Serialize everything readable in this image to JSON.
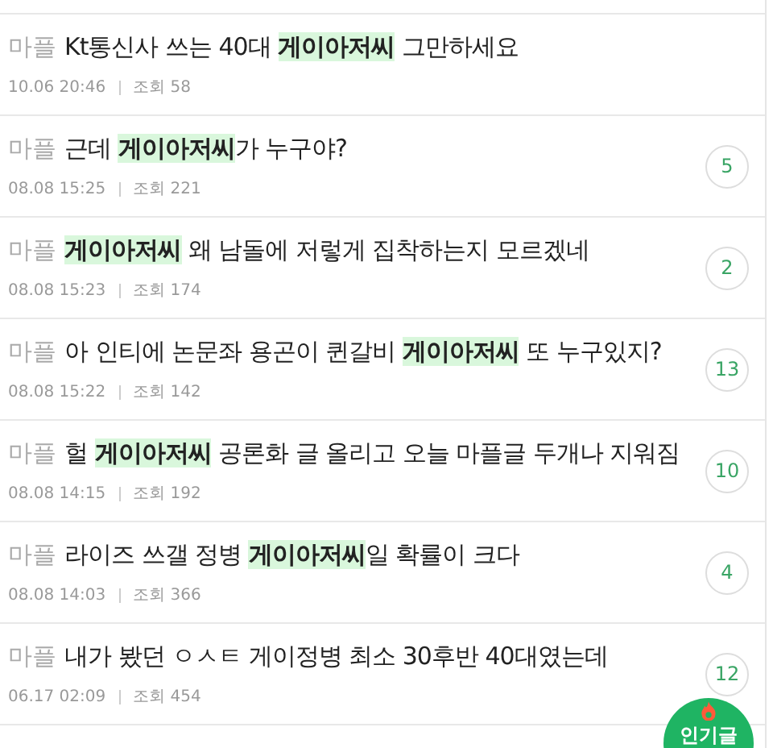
{
  "posts": [
    {
      "category": "마플",
      "title": [
        {
          "text": "Kt통신사 쓰는 40대 ",
          "highlight": false
        },
        {
          "text": "게이아저씨",
          "highlight": true
        },
        {
          "text": " 그만하세요",
          "highlight": false
        }
      ],
      "date": "10.06 20:46",
      "views": "조회 58"
    },
    {
      "category": "마플",
      "title": [
        {
          "text": "근데 ",
          "highlight": false
        },
        {
          "text": "게이아저씨",
          "highlight": true
        },
        {
          "text": "가 누구야?",
          "highlight": false
        }
      ],
      "date": "08.08 15:25",
      "views": "조회 221",
      "comments": "5"
    },
    {
      "category": "마플",
      "title": [
        {
          "text": "게이아저씨",
          "highlight": true
        },
        {
          "text": " 왜 남돌에 저렇게 집착하는지 모르겠네",
          "highlight": false
        }
      ],
      "date": "08.08 15:23",
      "views": "조회 174",
      "comments": "2"
    },
    {
      "category": "마플",
      "title": [
        {
          "text": "아 인티에 논문좌 용곤이 퀸갈비 ",
          "highlight": false
        },
        {
          "text": "게이아저씨",
          "highlight": true
        },
        {
          "text": " 또 누구있지?",
          "highlight": false
        }
      ],
      "date": "08.08 15:22",
      "views": "조회 142",
      "comments": "13"
    },
    {
      "category": "마플",
      "title": [
        {
          "text": "헐 ",
          "highlight": false
        },
        {
          "text": "게이아저씨",
          "highlight": true
        },
        {
          "text": " 공론화 글 올리고 오늘 마플글 두개나 지워짐",
          "highlight": false
        }
      ],
      "date": "08.08 14:15",
      "views": "조회 192",
      "comments": "10"
    },
    {
      "category": "마플",
      "title": [
        {
          "text": "라이즈 쓰갤 정병 ",
          "highlight": false
        },
        {
          "text": "게이아저씨",
          "highlight": true
        },
        {
          "text": "일 확률이 크다",
          "highlight": false
        }
      ],
      "date": "08.08 14:03",
      "views": "조회 366",
      "comments": "4"
    },
    {
      "category": "마플",
      "title": [
        {
          "text": "내가 봤던 ㅇㅅㅌ 게이정병 최소 30후반 40대였는데",
          "highlight": false
        }
      ],
      "date": "06.17 02:09",
      "views": "조회 454",
      "comments": "12"
    }
  ],
  "popular_button": {
    "label": "인기글"
  }
}
